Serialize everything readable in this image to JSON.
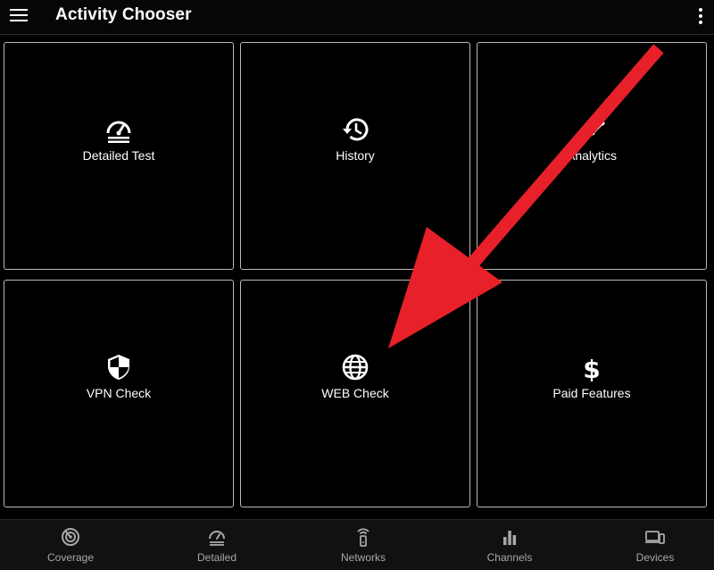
{
  "header": {
    "title": "Activity Chooser",
    "menu_icon": "hamburger-menu-icon",
    "overflow_icon": "more-vert-icon"
  },
  "tiles": [
    {
      "label": "Detailed Test",
      "icon": "speedometer-icon"
    },
    {
      "label": "History",
      "icon": "history-icon"
    },
    {
      "label": "Analytics",
      "icon": "analytics-icon"
    },
    {
      "label": "VPN Check",
      "icon": "shield-icon"
    },
    {
      "label": "WEB Check",
      "icon": "globe-icon"
    },
    {
      "label": "Paid Features",
      "icon": "dollar-icon"
    }
  ],
  "bottom_nav": [
    {
      "label": "Coverage",
      "icon": "radar-icon"
    },
    {
      "label": "Detailed",
      "icon": "speedometer-icon"
    },
    {
      "label": "Networks",
      "icon": "router-icon"
    },
    {
      "label": "Channels",
      "icon": "bar-chart-icon"
    },
    {
      "label": "Devices",
      "icon": "devices-icon"
    }
  ],
  "colors": {
    "background": "#000000",
    "tile_border": "#b9b9b9",
    "text": "#ffffff",
    "nav_label": "#a8a8a8",
    "annotation_arrow": "#e8202a"
  }
}
